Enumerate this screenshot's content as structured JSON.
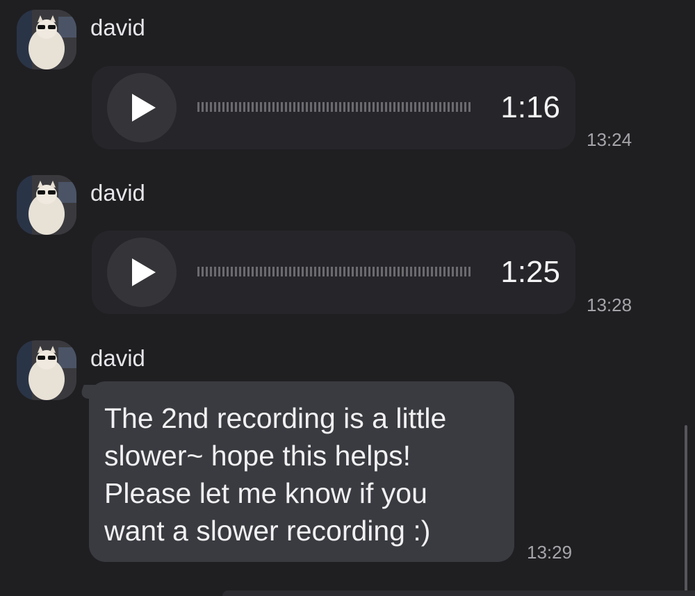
{
  "messages": [
    {
      "sender": "david",
      "type": "voice",
      "duration": "1:16",
      "time": "13:24"
    },
    {
      "sender": "david",
      "type": "voice",
      "duration": "1:25",
      "time": "13:28"
    },
    {
      "sender": "david",
      "type": "text",
      "text": "The 2nd recording is a little\nslower~ hope this helps!\nPlease let me know if you\nwant a slower recording :)",
      "time": "13:29"
    }
  ],
  "colors": {
    "background": "#1f1f22",
    "voice_bubble": "#26262a",
    "text_bubble": "#3a3b40"
  },
  "icons": {
    "play": "play-icon",
    "avatar": "cat-avatar-icon"
  }
}
